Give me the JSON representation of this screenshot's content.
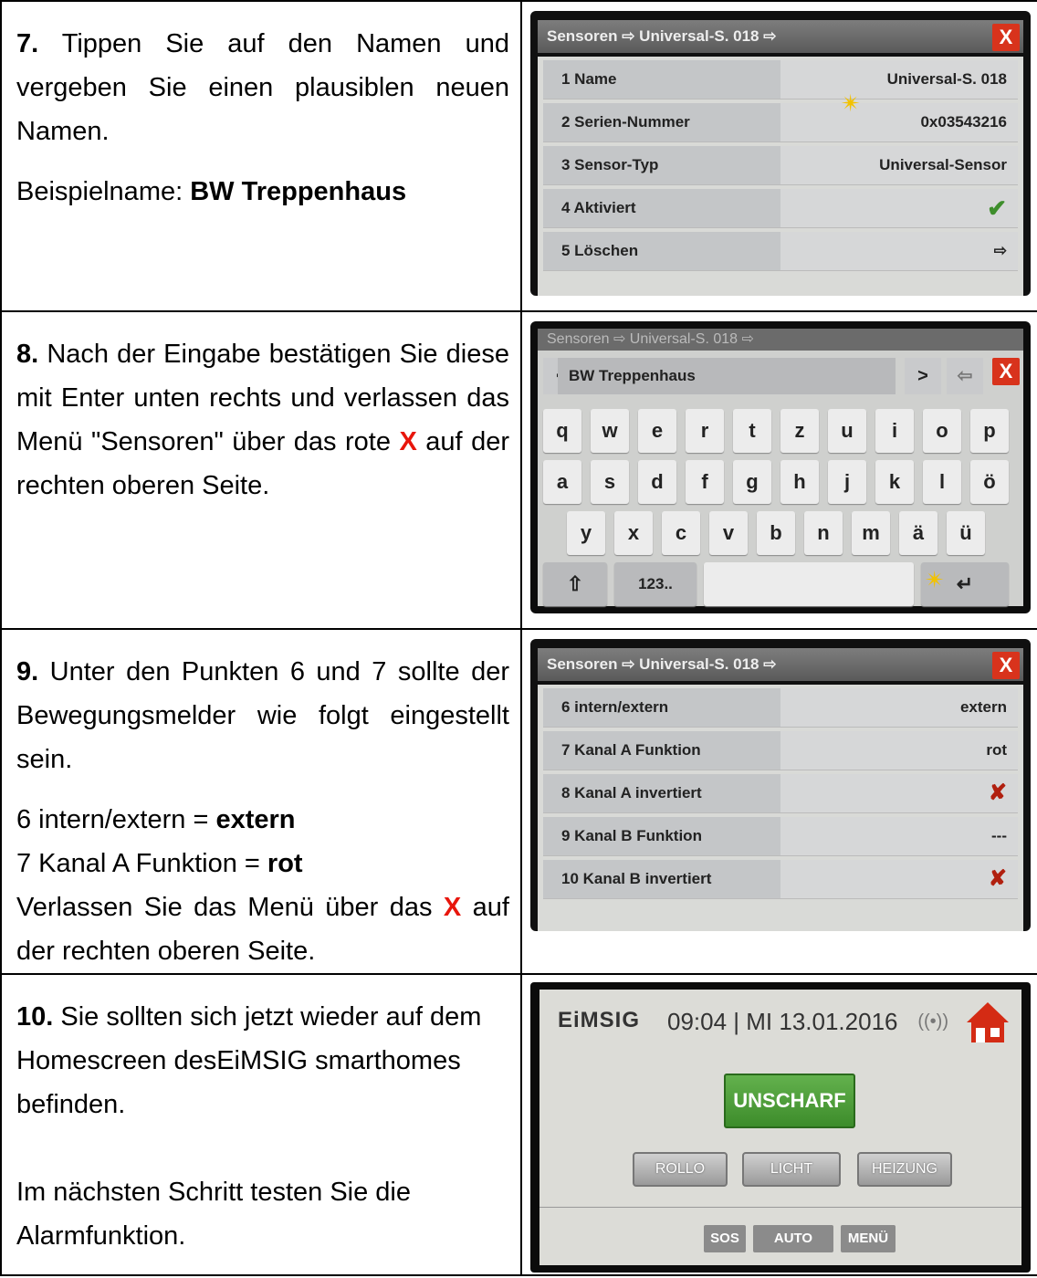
{
  "steps": [
    {
      "number": "7.",
      "text": "Tippen Sie auf den Namen und vergeben Sie einen plausiblen neuen Namen.",
      "example_label": "Beispielname: ",
      "example_value": "BW Treppenhaus"
    },
    {
      "number": "8.",
      "text_before": "Nach der Eingabe bestätigen Sie diese mit Enter unten rechts und verlassen das Menü \"Sensoren\" über das rote ",
      "highlight": "X",
      "text_after": " auf der rechten oberen Seite."
    },
    {
      "number": "9.",
      "text": "Unter den Punkten 6 und 7 sollte der Bewegungsmelder wie folgt eingestellt sein.",
      "setting1_label": "6 intern/extern = ",
      "setting1_value": "extern",
      "setting2_label": "7 Kanal A Funktion = ",
      "setting2_value": "rot",
      "leave_before": "Verlassen Sie das Menü über das ",
      "highlight": "X",
      "leave_after": " auf der rechten oberen Seite."
    },
    {
      "number": "10.",
      "text": "Sie sollten sich jetzt wieder auf dem Homescreen desEiMSIG smarthomes befinden.",
      "text2": "Im nächsten Schritt testen Sie die Alarmfunktion."
    }
  ],
  "shot1": {
    "title": "Sensoren ⇨ Universal-S. 018 ⇨",
    "close": "X",
    "rows": [
      {
        "label": "1 Name",
        "value": "Universal-S. 018"
      },
      {
        "label": "2 Serien-Nummer",
        "value": "0x03543216"
      },
      {
        "label": "3 Sensor-Typ",
        "value": "Universal-Sensor"
      },
      {
        "label": "4 Aktiviert",
        "value": "✔"
      },
      {
        "label": "5 Löschen",
        "value": "⇨"
      }
    ]
  },
  "shot2": {
    "title": "Sensoren ⇨ Universal-S. 018 ⇨",
    "input": "BW Treppenhaus",
    "prev": "<",
    "next": ">",
    "back": "⇦",
    "close": "X",
    "row1": [
      "q",
      "w",
      "e",
      "r",
      "t",
      "z",
      "u",
      "i",
      "o",
      "p"
    ],
    "row2": [
      "a",
      "s",
      "d",
      "f",
      "g",
      "h",
      "j",
      "k",
      "l",
      "ö"
    ],
    "row3": [
      "y",
      "x",
      "c",
      "v",
      "b",
      "n",
      "m",
      "ä",
      "ü"
    ],
    "shift": "⇧",
    "num": "123..",
    "enter": "↵"
  },
  "shot3": {
    "title": "Sensoren ⇨ Universal-S. 018 ⇨",
    "close": "X",
    "rows": [
      {
        "label": "6 intern/extern",
        "value": "extern"
      },
      {
        "label": "7 Kanal A Funktion",
        "value": "rot"
      },
      {
        "label": "8 Kanal A invertiert",
        "value": "✘"
      },
      {
        "label": "9 Kanal B Funktion",
        "value": "---"
      },
      {
        "label": "10 Kanal B invertiert",
        "value": "✘"
      }
    ]
  },
  "shot4": {
    "brand": "EiMSIG",
    "clock": "09:04 | MI 13.01.2016",
    "main_button": "UNSCHARF",
    "buttons": [
      "ROLLO",
      "LICHT",
      "HEIZUNG"
    ],
    "bottom": [
      "SOS",
      "AUTO",
      "MENÜ"
    ]
  }
}
